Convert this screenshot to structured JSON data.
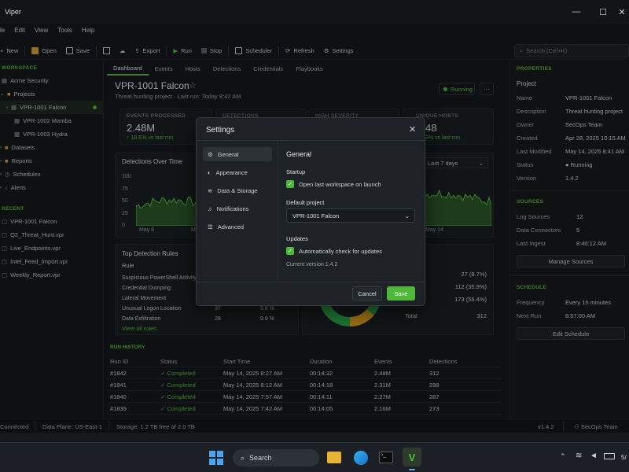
{
  "window": {
    "title": "Viper",
    "minimize": "—",
    "maximize": "☐",
    "close": "✕"
  },
  "menu": [
    "le",
    "Edit",
    "View",
    "Tools",
    "Help"
  ],
  "toolbar": {
    "new": "New",
    "open": "Open",
    "save": "Save",
    "export": "Export",
    "run": "Run",
    "stop": "Stop",
    "scheduler": "Scheduler",
    "refresh": "Refresh",
    "settings": "Settings"
  },
  "search": {
    "placeholder": "Search (Ctrl+K)"
  },
  "sidebar": {
    "workspace_h": "WORKSPACE",
    "items": [
      {
        "label": "Acme Security"
      },
      {
        "label": "Projects"
      },
      {
        "label": "VPR-1001 Falcon"
      },
      {
        "label": "VPR-1002 Mamba"
      },
      {
        "label": "VPR-1003 Hydra"
      },
      {
        "label": "Datasets"
      },
      {
        "label": "Reports"
      },
      {
        "label": "Schedules"
      },
      {
        "label": "Alerts"
      }
    ],
    "recent_h": "RECENT",
    "recent": [
      "VPR-1001 Falcon",
      "Q2_Threat_Hunt.vpr",
      "Live_Endpoints.vpr",
      "Intel_Feed_Import.vpr",
      "Weekly_Report.vpr"
    ]
  },
  "tabs": [
    "Dashboard",
    "Events",
    "Hosts",
    "Detections",
    "Credentials",
    "Playbooks"
  ],
  "project": {
    "title": "VPR-1001 Falcon",
    "star": "☆",
    "subtitle": "Threat hunting project  ·  Last run: Today 8:42 AM",
    "status": "Running",
    "more": "···"
  },
  "kpis": [
    {
      "label": "EVENTS PROCESSED",
      "value": "2.48M",
      "delta": "↑ 18.6% vs last run"
    },
    {
      "label": "DETECTIONS",
      "value": "",
      "delta": ""
    },
    {
      "label": "HIGH SEVERITY",
      "value": "",
      "delta": ""
    },
    {
      "label": "UNIQUE HOSTS",
      "value": "48",
      "delta": "3% vs last run"
    }
  ],
  "detections_chart": {
    "title": "Detections Over Time",
    "range": "Last 7 days",
    "yticks": [
      "100",
      "75",
      "50",
      "25",
      "0"
    ],
    "xticks": [
      "May 8",
      "May 9",
      "May 14"
    ]
  },
  "top_rules": {
    "title": "Top Detection Rules",
    "col": "Rule",
    "rows": [
      {
        "rule": "Suspicious PowerShell Activity",
        "count": "",
        "pct": ""
      },
      {
        "rule": "Credential Dumping",
        "count": "",
        "pct": ""
      },
      {
        "rule": "Lateral Movement",
        "count": "",
        "pct": ""
      },
      {
        "rule": "Unusual Logon Location",
        "count": "37",
        "pct": "5.6 %"
      },
      {
        "rule": "Data Exfiltration",
        "count": "28",
        "pct": "9.9 %"
      }
    ],
    "view_all": "View all rules"
  },
  "severity": {
    "rows": [
      {
        "count": "27 (8.7%)"
      },
      {
        "count": "112 (35.9%)"
      },
      {
        "count": "173 (55.4%)"
      }
    ],
    "total_label": "Total",
    "total": "312"
  },
  "run_history": {
    "title": "RUN HISTORY",
    "cols": [
      "Run ID",
      "Status",
      "Start Time",
      "Duration",
      "Events",
      "Detections"
    ],
    "rows": [
      {
        "id": "#1842",
        "status": "Completed",
        "start": "May 14, 2025 8:27 AM",
        "dur": "00:14:32",
        "events": "2.48M",
        "det": "312"
      },
      {
        "id": "#1841",
        "status": "Completed",
        "start": "May 14, 2025 8:12 AM",
        "dur": "00:14:18",
        "events": "2.31M",
        "det": "298"
      },
      {
        "id": "#1840",
        "status": "Completed",
        "start": "May 14, 2025 7:57 AM",
        "dur": "00:14:11",
        "events": "2.27M",
        "det": "287"
      },
      {
        "id": "#1839",
        "status": "Completed",
        "start": "May 14, 2025 7:42 AM",
        "dur": "00:14:05",
        "events": "2.16M",
        "det": "273"
      }
    ]
  },
  "properties": {
    "h": "PROPERTIES",
    "project_h": "Project",
    "rows": [
      {
        "k": "Name",
        "v": "VPR-1001 Falcon"
      },
      {
        "k": "Description",
        "v": "Threat hunting project"
      },
      {
        "k": "Owner",
        "v": "SecOps Team"
      },
      {
        "k": "Created",
        "v": "Apr 28, 2025 10:15 AM"
      },
      {
        "k": "Last Modified",
        "v": "May 14, 2025 8:41 AM"
      },
      {
        "k": "Status",
        "v": "Running"
      },
      {
        "k": "Version",
        "v": "1.4.2"
      }
    ]
  },
  "sources": {
    "h": "SOURCES",
    "rows": [
      {
        "k": "Log Sources",
        "v": "12"
      },
      {
        "k": "Data Connectors",
        "v": "5"
      },
      {
        "k": "Last Ingest",
        "v": "8:40:12 AM"
      }
    ],
    "btn": "Manage Sources"
  },
  "schedule": {
    "h": "SCHEDULE",
    "rows": [
      {
        "k": "Frequency",
        "v": "Every 15 minutes"
      },
      {
        "k": "Next Run",
        "v": "8:57:00 AM"
      }
    ],
    "btn": "Edit Schedule"
  },
  "statusbar": {
    "conn": "Connected",
    "plane": "Data Plane: US-East-1",
    "storage": "Storage: 1.2 TB free of 2.0 TB",
    "version": "v1.4.2",
    "team": "SecOps Team"
  },
  "settings": {
    "title": "Settings",
    "close": "✕",
    "nav": [
      "General",
      "Appearance",
      "Data & Storage",
      "Notifications",
      "Advanced"
    ],
    "section": "General",
    "startup_h": "Startup",
    "startup_opt": "Open last workspace on launch",
    "default_h": "Default project",
    "default_val": "VPR-1001 Falcon",
    "updates_h": "Updates",
    "updates_opt": "Automatically check for updates",
    "current": "Current version 1.4.2",
    "cancel": "Cancel",
    "save": "Save"
  },
  "taskbar": {
    "search": "Search",
    "clock": "5/"
  },
  "colors": {
    "accent": "#4fc03a",
    "bg": "#16191c",
    "dialog": "#1e2226"
  }
}
